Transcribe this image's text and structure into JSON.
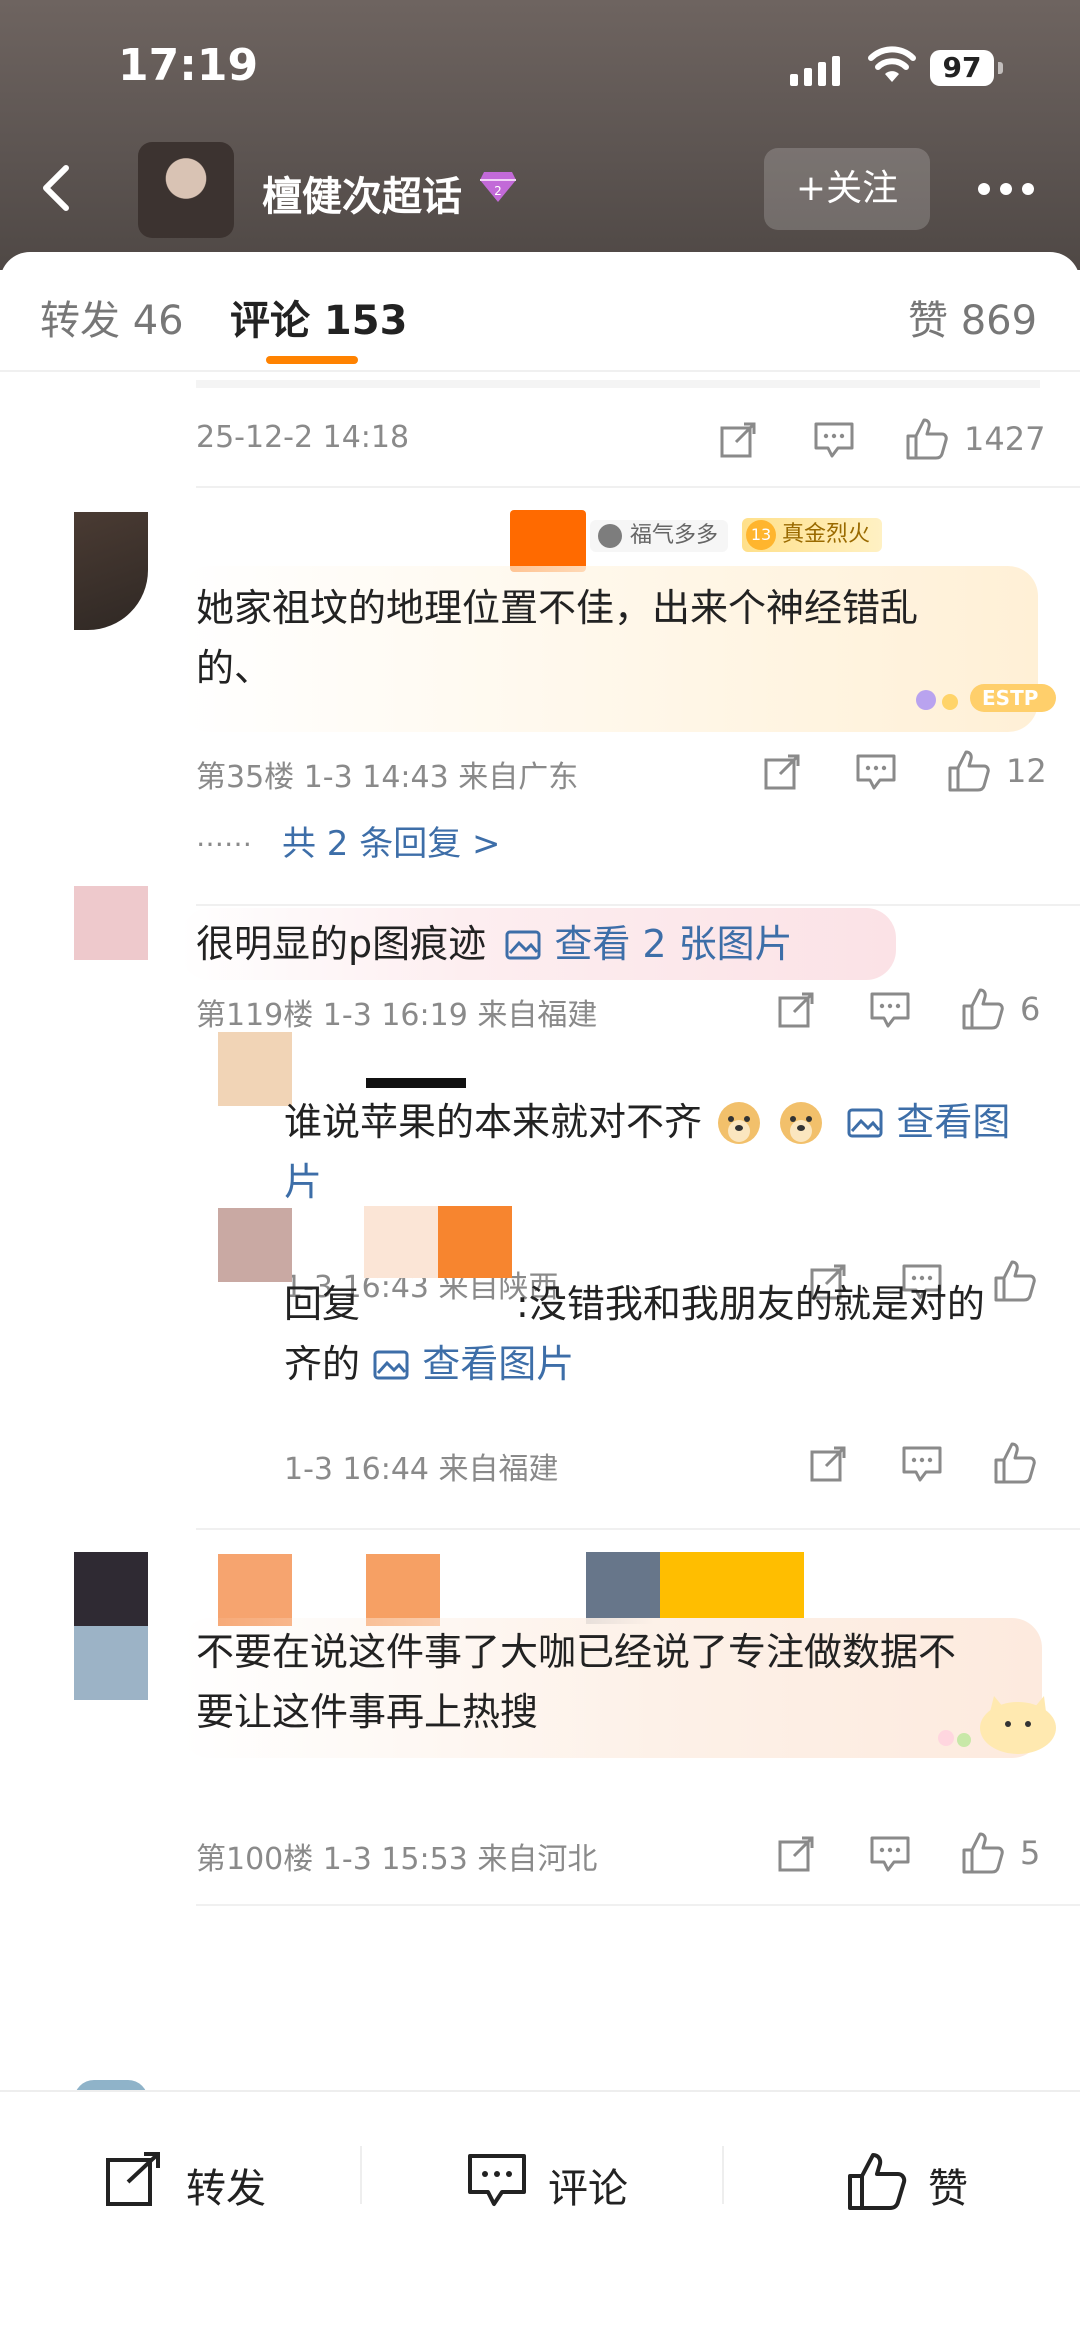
{
  "status_bar": {
    "time": "17:19",
    "battery": "97"
  },
  "header": {
    "title": "檀健次超话",
    "follow_label": "+关注"
  },
  "tabs": [
    {
      "label": "转发 46"
    },
    {
      "label": "评论 153"
    },
    {
      "label": "赞 869"
    }
  ],
  "top_meta": {
    "date": "25-12-2 14:18",
    "likes": "1427"
  },
  "comments": [
    {
      "badge1": "福气多多",
      "badge2_level": "13",
      "badge2": "真金烈火",
      "text_line1": "她家祖坟的地理位置不佳，出来个神经错乱",
      "text_line2": "的、",
      "sticker_text": "ESTP",
      "meta": "第35楼 1-3 14:43 来自广东",
      "likes": "12",
      "replies_prefix": "……",
      "replies": "共 2 条回复 >"
    },
    {
      "text": "很明显的p图痕迹",
      "image_link": "查看 2 张图片",
      "meta": "第119楼 1-3 16:19 来自福建",
      "likes": "6",
      "replies": [
        {
          "text_line1": "谁说苹果的本来就对不齐",
          "image_link": "查看图",
          "text_line2": "片",
          "meta": "1-3 16:43 来自陕西"
        },
        {
          "reply_prefix": "回复",
          "text_line1": ":没错我和我朋友的就是对的",
          "text_line2": "齐的",
          "image_link": "查看图片",
          "meta": "1-3 16:44 来自福建"
        }
      ]
    },
    {
      "text_line1": "不要在说这件事了大咖已经说了专注做数据不",
      "text_line2": "要让这件事再上热搜",
      "meta": "第100楼 1-3 15:53 来自河北",
      "likes": "5"
    }
  ],
  "bottom_bar": {
    "repost": "转发",
    "comment": "评论",
    "like": "赞"
  },
  "colors": {
    "accent": "#ff8200",
    "link": "#3d6ea8",
    "header_bg": "#5d5552"
  }
}
